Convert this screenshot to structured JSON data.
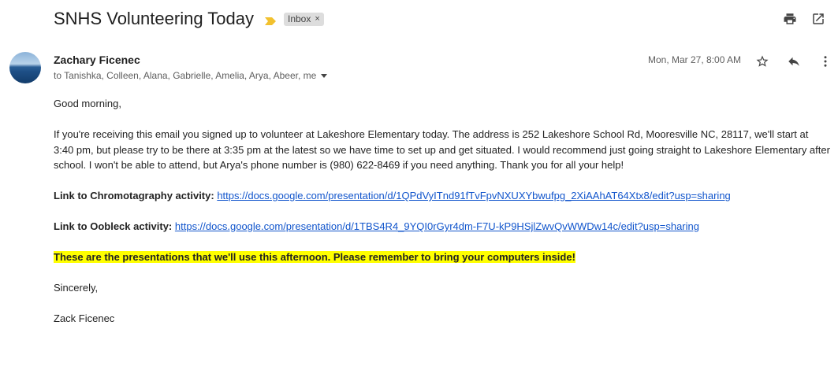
{
  "email": {
    "subject": "SNHS Volunteering Today",
    "label_chip": "Inbox",
    "label_chip_close": "×",
    "sender_name": "Zachary Ficenec",
    "recipients": "to Tanishka, Colleen, Alana, Gabrielle, Amelia, Arya, Abeer, me",
    "date": "Mon, Mar 27, 8:00 AM",
    "icons": {
      "top": [
        "print-icon",
        "open-in-new-window-icon"
      ],
      "message": [
        "star-icon",
        "reply-icon",
        "more-options-icon"
      ],
      "important_marker": "importance-marker-icon"
    },
    "colors": {
      "link": "#1155cc",
      "highlight": "#ffff00",
      "important_marker": "#f2c12e"
    }
  },
  "body": {
    "greeting": "Good morning,",
    "paragraph": "If you're receiving this email you signed up to volunteer at Lakeshore Elementary today. The address is 252 Lakeshore School Rd, Mooresville NC, 28117, we'll start at 3:40 pm, but please try to be there at 3:35 pm at the latest so we have time to set up and get situated. I would recommend just going straight to Lakeshore Elementary after school. I won't be able to attend, but Arya's phone number is (980) 622-8469 if you need anything. Thank you for all your help!",
    "link1_label": "Link to Chromotagraphy activity:",
    "link1_url": "https://docs.google.com/presentation/d/1QPdVyITnd91fTvFpvNXUXYbwufpg_2XiAAhAT64Xtx8/edit?usp=sharing",
    "link2_label": "Link to Oobleck activity:",
    "link2_url": "https://docs.google.com/presentation/d/1TBS4R4_9YQI0rGyr4dm-F7U-kP9HSjlZwvQvWWDw14c/edit?usp=sharing",
    "highlight_text": "These are the presentations that we'll use this afternoon. Please remember to bring your computers inside!",
    "closing": "Sincerely,",
    "signature": "Zack Ficenec"
  }
}
